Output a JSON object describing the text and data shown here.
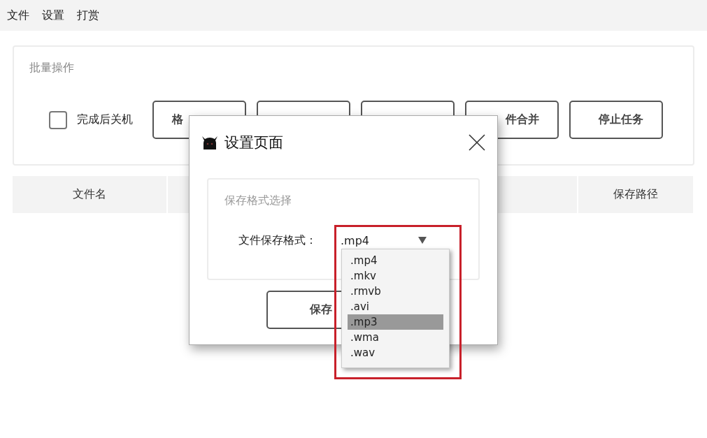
{
  "menu": [
    "文件",
    "设置",
    "打赏"
  ],
  "batch": {
    "title": "批量操作",
    "shutdown": {
      "label": "完成后关机",
      "checked": false
    },
    "buttons": [
      {
        "kind": "labeled",
        "label": "格"
      },
      {
        "kind": "covered"
      },
      {
        "kind": "covered"
      },
      {
        "kind": "labeled",
        "label": "件合并"
      },
      {
        "kind": "labeled",
        "label": "停止任务"
      }
    ]
  },
  "table": {
    "columns": [
      "文件名",
      "保存路径"
    ]
  },
  "dialog": {
    "title": "设置页面",
    "group_title": "保存格式选择",
    "field_label": "文件保存格式：",
    "combo": {
      "value": ".mp4",
      "expanded": true
    },
    "options": [
      {
        "label": ".mp4",
        "selected": false
      },
      {
        "label": ".mkv",
        "selected": false
      },
      {
        "label": ".rmvb",
        "selected": false
      },
      {
        "label": ".avi",
        "selected": false
      },
      {
        "label": ".mp3",
        "selected": true
      },
      {
        "label": ".wma",
        "selected": false
      },
      {
        "label": ".wav",
        "selected": false
      }
    ],
    "save_button": "保存"
  }
}
